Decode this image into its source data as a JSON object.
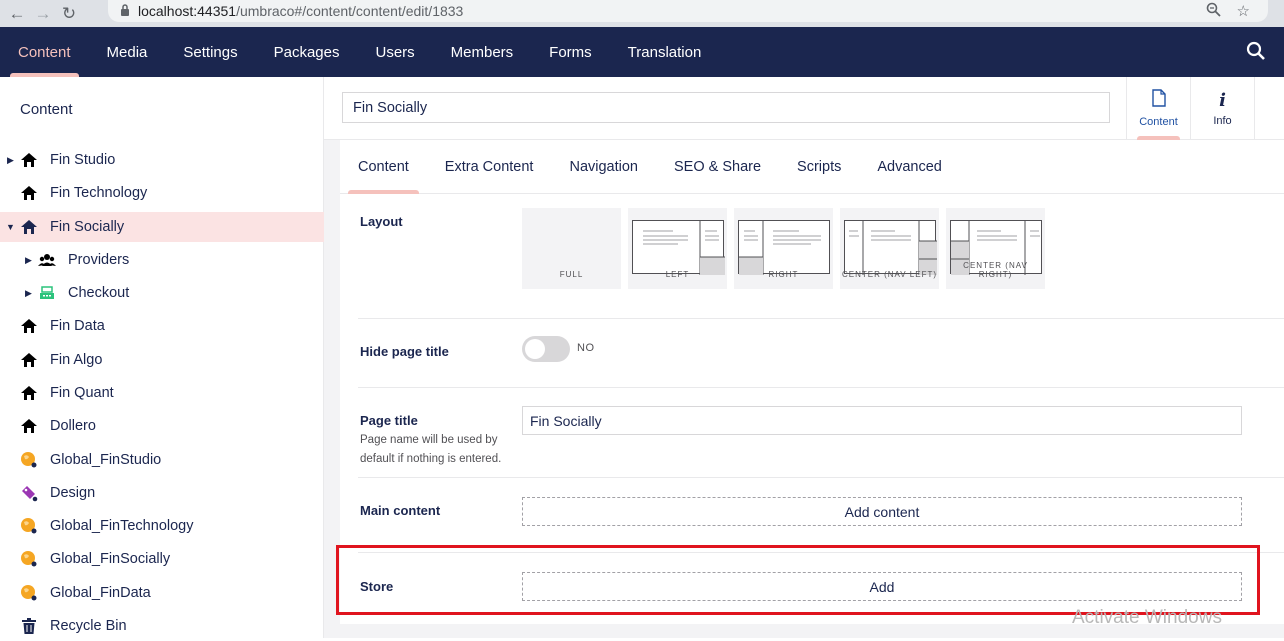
{
  "browser": {
    "url_host": "localhost:44351",
    "url_path": "/umbraco#/content/content/edit/1833"
  },
  "topnav": {
    "items": [
      "Content",
      "Media",
      "Settings",
      "Packages",
      "Users",
      "Members",
      "Forms",
      "Translation"
    ],
    "active": "Content"
  },
  "sidebar": {
    "title": "Content",
    "items": [
      {
        "label": "Fin Studio",
        "icon": "home-icon",
        "expander": "collapsed"
      },
      {
        "label": "Fin Technology",
        "icon": "home-icon",
        "expander": "none"
      },
      {
        "label": "Fin Socially",
        "icon": "home-icon",
        "expander": "expanded",
        "active": true
      },
      {
        "label": "Providers",
        "icon": "users-icon",
        "expander": "collapsed",
        "child": true
      },
      {
        "label": "Checkout",
        "icon": "register-icon",
        "expander": "collapsed",
        "child": true
      },
      {
        "label": "Fin Data",
        "icon": "home-icon",
        "expander": "none"
      },
      {
        "label": "Fin Algo",
        "icon": "home-icon",
        "expander": "none"
      },
      {
        "label": "Fin Quant",
        "icon": "home-icon",
        "expander": "none"
      },
      {
        "label": "Dollero",
        "icon": "home-icon",
        "expander": "none"
      },
      {
        "label": "Global_FinStudio",
        "icon": "globe-icon",
        "expander": "none"
      },
      {
        "label": "Design",
        "icon": "tag-icon",
        "expander": "none"
      },
      {
        "label": "Global_FinTechnology",
        "icon": "globe-icon",
        "expander": "none"
      },
      {
        "label": "Global_FinSocially",
        "icon": "globe-icon",
        "expander": "none"
      },
      {
        "label": "Global_FinData",
        "icon": "globe-icon",
        "expander": "none"
      },
      {
        "label": "Recycle Bin",
        "icon": "trash-icon",
        "expander": "none"
      }
    ]
  },
  "editor": {
    "node_name": "Fin Socially",
    "apps": [
      {
        "label": "Content",
        "icon": "document-icon",
        "active": true
      },
      {
        "label": "Info",
        "icon": "info-icon",
        "active": false
      }
    ],
    "tabs": [
      "Content",
      "Extra Content",
      "Navigation",
      "SEO & Share",
      "Scripts",
      "Advanced"
    ],
    "active_tab": "Content"
  },
  "properties": {
    "layout": {
      "label": "Layout",
      "options": [
        "FULL",
        "LEFT",
        "RIGHT",
        "CENTER (NAV LEFT)",
        "CENTER (NAV RIGHT)"
      ]
    },
    "hide_title": {
      "label": "Hide page title",
      "toggle_text": "NO",
      "on": false
    },
    "page_title": {
      "label": "Page title",
      "description": "Page name will be used by default if nothing is entered.",
      "value": "Fin Socially"
    },
    "main_content": {
      "label": "Main content",
      "button": "Add content"
    },
    "store": {
      "label": "Store",
      "button": "Add"
    }
  },
  "overlay": {
    "watermark": "Activate Windows"
  },
  "colors": {
    "nav_bg": "#1b264f",
    "accent": "#f5c1bc",
    "highlight": "#e0141e",
    "active_tree_bg": "#fbe3e3"
  }
}
